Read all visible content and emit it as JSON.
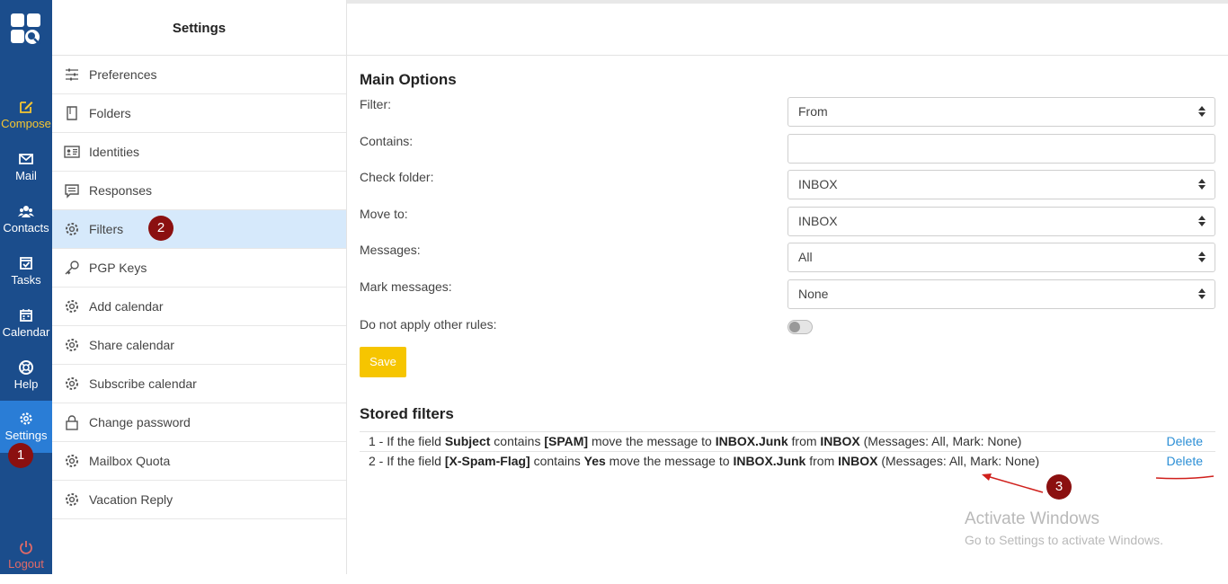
{
  "taskbar": {
    "items": [
      {
        "label": "Compose",
        "icon": "compose-icon"
      },
      {
        "label": "Mail",
        "icon": "mail-icon"
      },
      {
        "label": "Contacts",
        "icon": "contacts-icon"
      },
      {
        "label": "Tasks",
        "icon": "tasks-icon"
      },
      {
        "label": "Calendar",
        "icon": "calendar-icon"
      },
      {
        "label": "Help",
        "icon": "help-icon"
      },
      {
        "label": "Settings",
        "icon": "gear-icon"
      },
      {
        "label": "Logout",
        "icon": "power-icon"
      }
    ],
    "active": "Settings",
    "colors": {
      "bg": "#1b4d8c",
      "active": "#2a7dd6",
      "compose": "#f6c631",
      "logout": "#e26a67"
    }
  },
  "settings": {
    "title": "Settings",
    "items": [
      {
        "label": "Preferences",
        "icon": "sliders-icon"
      },
      {
        "label": "Folders",
        "icon": "folder-icon"
      },
      {
        "label": "Identities",
        "icon": "id-card-icon"
      },
      {
        "label": "Responses",
        "icon": "message-icon"
      },
      {
        "label": "Filters",
        "icon": "gear-icon"
      },
      {
        "label": "PGP Keys",
        "icon": "key-icon"
      },
      {
        "label": "Add calendar",
        "icon": "gear-icon"
      },
      {
        "label": "Share calendar",
        "icon": "gear-icon"
      },
      {
        "label": "Subscribe calendar",
        "icon": "gear-icon"
      },
      {
        "label": "Change password",
        "icon": "lock-icon"
      },
      {
        "label": "Mailbox Quota",
        "icon": "gear-icon"
      },
      {
        "label": "Vacation Reply",
        "icon": "gear-icon"
      }
    ],
    "active": "Filters"
  },
  "main": {
    "options_title": "Main Options",
    "fields": {
      "filter": {
        "label": "Filter:",
        "value": "From"
      },
      "contains": {
        "label": "Contains:",
        "value": ""
      },
      "check_folder": {
        "label": "Check folder:",
        "value": "INBOX"
      },
      "move_to": {
        "label": "Move to:",
        "value": "INBOX"
      },
      "messages": {
        "label": "Messages:",
        "value": "All"
      },
      "mark_messages": {
        "label": "Mark messages:",
        "value": "None"
      },
      "no_other_rules": {
        "label": "Do not apply other rules:",
        "value": "off"
      }
    },
    "save_label": "Save",
    "stored_title": "Stored filters",
    "delete_label": "Delete",
    "filters": [
      {
        "prefix": "1 - If the field ",
        "field": "Subject",
        "contains_text": " contains ",
        "value": "[SPAM]",
        "move_text": " move the message to ",
        "target": "INBOX.Junk",
        "from_text": " from ",
        "source": "INBOX",
        "suffix": " (Messages: All, Mark: None)"
      },
      {
        "prefix": "2 - If the field ",
        "field": "[X-Spam-Flag]",
        "contains_text": " contains ",
        "value": "Yes",
        "move_text": " move the message to ",
        "target": "INBOX.Junk",
        "from_text": " from ",
        "source": "INBOX",
        "suffix": " (Messages: All, Mark: None)"
      }
    ]
  },
  "annotations": {
    "badge1": "1",
    "badge2": "2",
    "badge3": "3"
  },
  "watermark": {
    "title": "Activate Windows",
    "subtitle": "Go to Settings to activate Windows."
  }
}
